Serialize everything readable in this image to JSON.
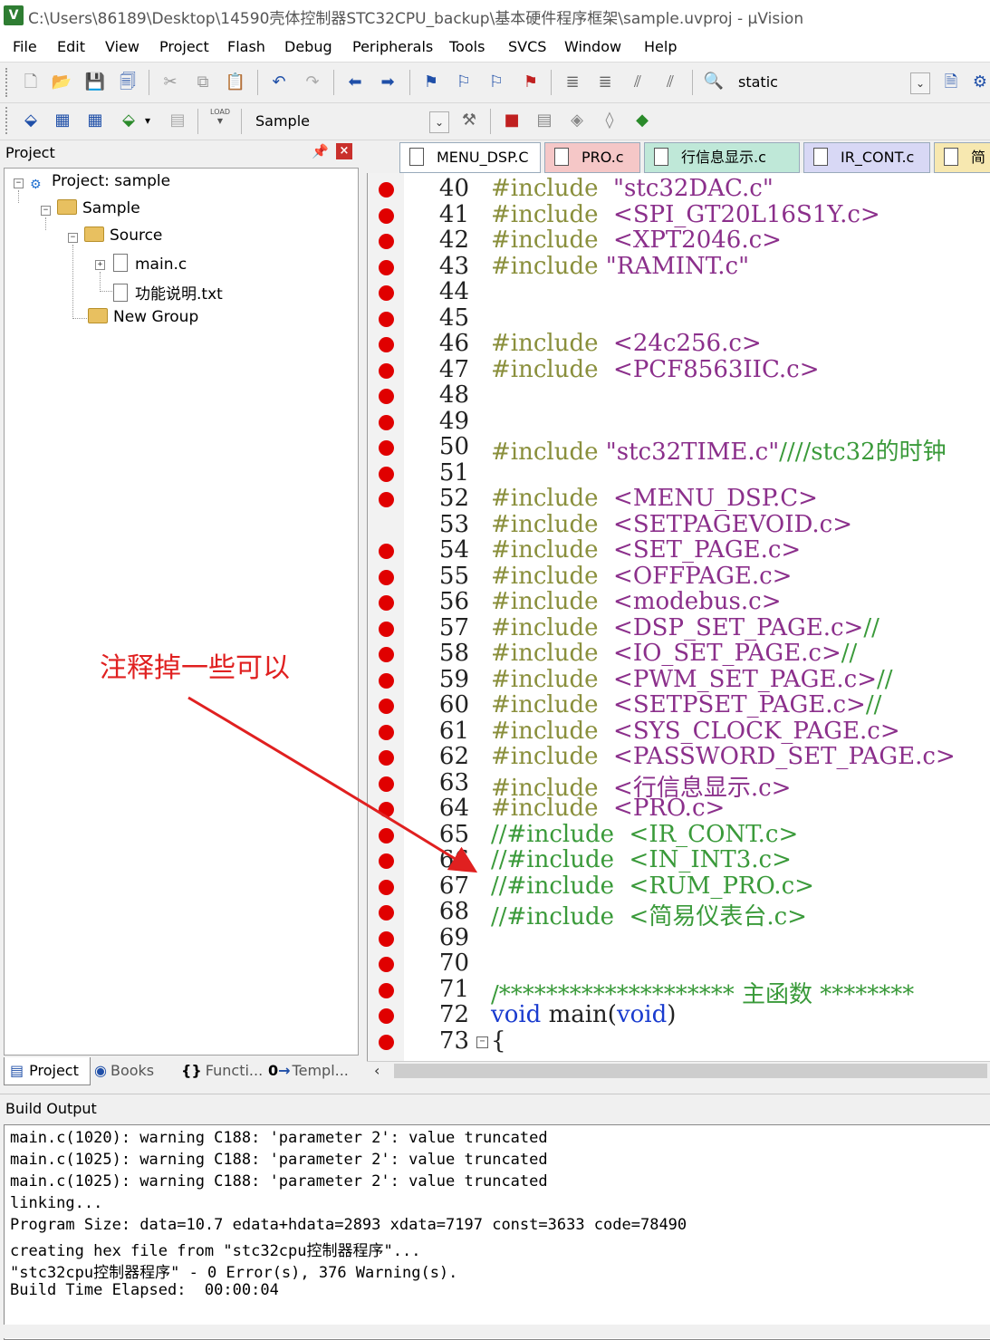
{
  "window": {
    "app_icon": "V",
    "title": "C:\\Users\\86189\\Desktop\\14590壳体控制器STC32CPU_backup\\基本硬件程序框架\\sample.uvproj - µVision"
  },
  "menu": [
    "File",
    "Edit",
    "View",
    "Project",
    "Flash",
    "Debug",
    "Peripherals",
    "Tools",
    "SVCS",
    "Window",
    "Help"
  ],
  "toolbar1": {
    "find_combo_value": "static"
  },
  "toolbar2": {
    "load_label": "LOAD",
    "target_combo_value": "Sample"
  },
  "project_panel": {
    "title": "Project",
    "tree": {
      "project": "Project: sample",
      "target": "Sample",
      "source_group": "Source",
      "files": [
        "main.c",
        "功能说明.txt"
      ],
      "new_group": "New Group"
    },
    "tabs": [
      "Project",
      "Books",
      "Functi...",
      "Templ..."
    ],
    "tab_icons": [
      "{}",
      "0"
    ]
  },
  "editor_tabs": [
    "MENU_DSP.C",
    "PRO.c",
    "行信息显示.c",
    "IR_CONT.c",
    "简"
  ],
  "code_lines": [
    {
      "n": "40",
      "bp": true,
      "parts": [
        [
          "kw",
          "#include  "
        ],
        [
          "str",
          "\"stc32DAC.c\""
        ]
      ]
    },
    {
      "n": "41",
      "bp": true,
      "parts": [
        [
          "kw",
          "#include  "
        ],
        [
          "str",
          "<SPI_GT20L16S1Y.c>"
        ]
      ]
    },
    {
      "n": "42",
      "bp": true,
      "parts": [
        [
          "kw",
          "#include  "
        ],
        [
          "str",
          "<XPT2046.c>"
        ]
      ]
    },
    {
      "n": "43",
      "bp": true,
      "parts": [
        [
          "kw",
          "#include "
        ],
        [
          "str",
          "\"RAMINT.c\""
        ]
      ]
    },
    {
      "n": "44",
      "bp": true,
      "parts": []
    },
    {
      "n": "45",
      "bp": true,
      "parts": []
    },
    {
      "n": "46",
      "bp": true,
      "parts": [
        [
          "kw",
          "#include  "
        ],
        [
          "str",
          "<24c256.c>"
        ]
      ]
    },
    {
      "n": "47",
      "bp": true,
      "parts": [
        [
          "kw",
          "#include  "
        ],
        [
          "str",
          "<PCF8563IIC.c>"
        ]
      ]
    },
    {
      "n": "48",
      "bp": true,
      "parts": []
    },
    {
      "n": "49",
      "bp": true,
      "parts": []
    },
    {
      "n": "50",
      "bp": true,
      "parts": [
        [
          "kw",
          "#include "
        ],
        [
          "str",
          "\"stc32TIME.c\""
        ],
        [
          "cm",
          "////stc32的时钟"
        ]
      ]
    },
    {
      "n": "51",
      "bp": true,
      "parts": []
    },
    {
      "n": "52",
      "bp": true,
      "parts": [
        [
          "kw",
          "#include  "
        ],
        [
          "str",
          "<MENU_DSP.C>"
        ]
      ]
    },
    {
      "n": "53",
      "bp": false,
      "parts": [
        [
          "kw",
          "#include  "
        ],
        [
          "str",
          "<SETPAGEVOID.c>"
        ]
      ]
    },
    {
      "n": "54",
      "bp": true,
      "parts": [
        [
          "kw",
          "#include  "
        ],
        [
          "str",
          "<SET_PAGE.c>"
        ]
      ]
    },
    {
      "n": "55",
      "bp": true,
      "parts": [
        [
          "kw",
          "#include  "
        ],
        [
          "str",
          "<OFFPAGE.c>"
        ]
      ]
    },
    {
      "n": "56",
      "bp": true,
      "parts": [
        [
          "kw",
          "#include  "
        ],
        [
          "str",
          "<modebus.c>"
        ]
      ]
    },
    {
      "n": "57",
      "bp": true,
      "parts": [
        [
          "kw",
          "#include  "
        ],
        [
          "str",
          "<DSP_SET_PAGE.c>"
        ],
        [
          "cm",
          "//"
        ]
      ]
    },
    {
      "n": "58",
      "bp": true,
      "parts": [
        [
          "kw",
          "#include  "
        ],
        [
          "str",
          "<IO_SET_PAGE.c>"
        ],
        [
          "cm",
          "//"
        ]
      ]
    },
    {
      "n": "59",
      "bp": true,
      "parts": [
        [
          "kw",
          "#include  "
        ],
        [
          "str",
          "<PWM_SET_PAGE.c>"
        ],
        [
          "cm",
          "//"
        ]
      ]
    },
    {
      "n": "60",
      "bp": true,
      "parts": [
        [
          "kw",
          "#include  "
        ],
        [
          "str",
          "<SETPSET_PAGE.c>"
        ],
        [
          "cm",
          "//"
        ]
      ]
    },
    {
      "n": "61",
      "bp": true,
      "parts": [
        [
          "kw",
          "#include  "
        ],
        [
          "str",
          "<SYS_CLOCK_PAGE.c>"
        ]
      ]
    },
    {
      "n": "62",
      "bp": true,
      "parts": [
        [
          "kw",
          "#include  "
        ],
        [
          "str",
          "<PASSWORD_SET_PAGE.c>"
        ]
      ]
    },
    {
      "n": "63",
      "bp": true,
      "parts": [
        [
          "kw",
          "#include  "
        ],
        [
          "str",
          "<行信息显示.c>"
        ]
      ]
    },
    {
      "n": "64",
      "bp": true,
      "parts": [
        [
          "kw",
          "#include  "
        ],
        [
          "str",
          "<PRO.c>"
        ]
      ]
    },
    {
      "n": "65",
      "bp": true,
      "parts": [
        [
          "cm",
          "//#include  <IR_CONT.c>"
        ]
      ]
    },
    {
      "n": "66",
      "bp": true,
      "parts": [
        [
          "cm",
          "//#include  <IN_INT3.c>"
        ]
      ]
    },
    {
      "n": "67",
      "bp": true,
      "parts": [
        [
          "cm",
          "//#include  <RUM_PRO.c>"
        ]
      ]
    },
    {
      "n": "68",
      "bp": true,
      "parts": [
        [
          "cm",
          "//#include  <简易仪表台.c>"
        ]
      ]
    },
    {
      "n": "69",
      "bp": true,
      "parts": []
    },
    {
      "n": "70",
      "bp": true,
      "parts": []
    },
    {
      "n": "71",
      "bp": true,
      "parts": [
        [
          "cm",
          "/******************** 主函数 ********"
        ]
      ]
    },
    {
      "n": "72",
      "bp": true,
      "parts": [
        [
          "kw2",
          "void "
        ],
        [
          "tx",
          "main("
        ],
        [
          "kw2",
          "void"
        ],
        [
          "tx",
          ")"
        ]
      ]
    },
    {
      "n": "73",
      "bp": true,
      "parts": [
        [
          "tx",
          "{"
        ]
      ]
    }
  ],
  "annotation": {
    "text": "注释掉一些可以",
    "color": "#e02020"
  },
  "build_output": {
    "title": "Build Output",
    "lines": [
      "main.c(1020): warning C188: 'parameter 2': value truncated",
      "main.c(1025): warning C188: 'parameter 2': value truncated",
      "main.c(1025): warning C188: 'parameter 2': value truncated",
      "linking...",
      "Program Size: data=10.7 edata+hdata=2893 xdata=7197 const=3633 code=78490",
      "creating hex file from \"stc32cpu控制器程序\"...",
      "\"stc32cpu控制器程序\" - 0 Error(s), 376 Warning(s).",
      "Build Time Elapsed:  00:00:04"
    ]
  },
  "colors": {
    "breakpoint": "#e00000",
    "keyword": "#8a8f3c",
    "string": "#8b2f8b",
    "comment": "#3a9a3a",
    "type": "#1a3ccf"
  }
}
